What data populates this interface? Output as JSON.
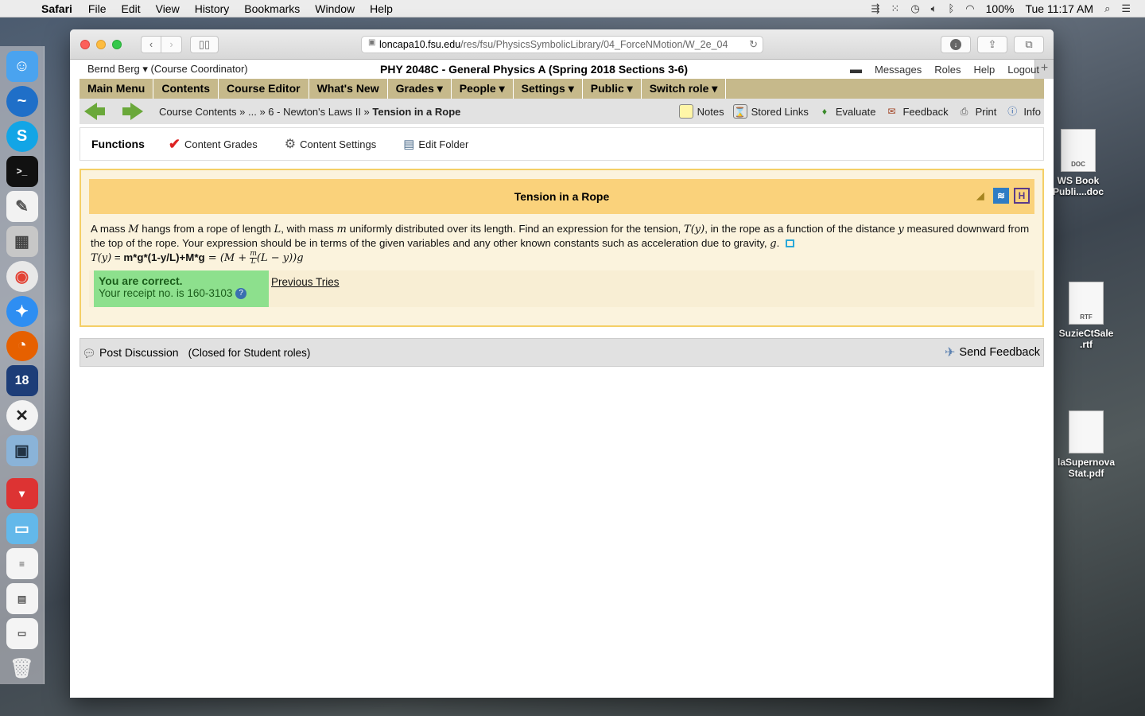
{
  "menubar": {
    "app": "Safari",
    "items": [
      "File",
      "Edit",
      "View",
      "History",
      "Bookmarks",
      "Window",
      "Help"
    ],
    "battery": "100%",
    "clock": "Tue 11:17 AM"
  },
  "desktop": {
    "files": [
      {
        "name": "WS Book Publi....doc",
        "type": "DOC"
      },
      {
        "name": "SuzieCtSale .rtf",
        "type": "RTF"
      },
      {
        "name": "laSupernova Stat.pdf",
        "type": ""
      }
    ]
  },
  "browser": {
    "url_host": "loncapa10.fsu.edu",
    "url_path": "/res/fsu/PhysicsSymbolicLibrary/04_ForceNMotion/W_2e_04"
  },
  "header": {
    "user": "Bernd Berg ▾ (Course Coordinator)",
    "course": "PHY 2048C - General Physics A (Spring 2018 Sections 3-6)",
    "links": [
      "Messages",
      "Roles",
      "Help",
      "Logout"
    ]
  },
  "mainnav": [
    "Main Menu",
    "Contents",
    "Course Editor",
    "What's New",
    "Grades ▾",
    "People ▾",
    "Settings ▾",
    "Public ▾",
    "Switch role ▾"
  ],
  "breadcrumb": {
    "path": "Course Contents » ... » 6 - Newton's Laws II » ",
    "current": "Tension in a Rope"
  },
  "tools": [
    "Notes",
    "Stored Links",
    "Evaluate",
    "Feedback",
    "Print",
    "Info"
  ],
  "functions": {
    "heading": "Functions",
    "items": [
      "Content Grades",
      "Content Settings",
      "Edit Folder"
    ]
  },
  "problem": {
    "title": "Tension in a Rope",
    "text1": "A mass ",
    "var_M": "M",
    "text2": " hangs from a rope of length ",
    "var_L": "L",
    "text3": ", with mass ",
    "var_m": "m",
    "text4": " uniformly distributed over its length. Find an expression for the tension, ",
    "var_Ty": "T(y)",
    "text5": ", in the rope as a function of the distance ",
    "var_y": "y",
    "text6": " measured downward from the top of the rope. Your expression should be in terms of the given variables and any other known constants such as acceleration due to gravity, ",
    "var_g": "g",
    "text7": ".",
    "answer_lhs": "T(y)",
    "answer_eq": " = ",
    "answer_input": "m*g*(1-y/L)+M*g",
    "answer_rendered_a": " = (M + ",
    "answer_frac_num": "m",
    "answer_frac_den": "L",
    "answer_rendered_b": "(L − y))g",
    "result": "You are correct.",
    "receipt": "Your receipt no. is 160-3103",
    "prev_tries": "Previous Tries"
  },
  "discussion": {
    "post": "Post Discussion",
    "closed": "(Closed for Student roles)",
    "send": "Send Feedback"
  }
}
